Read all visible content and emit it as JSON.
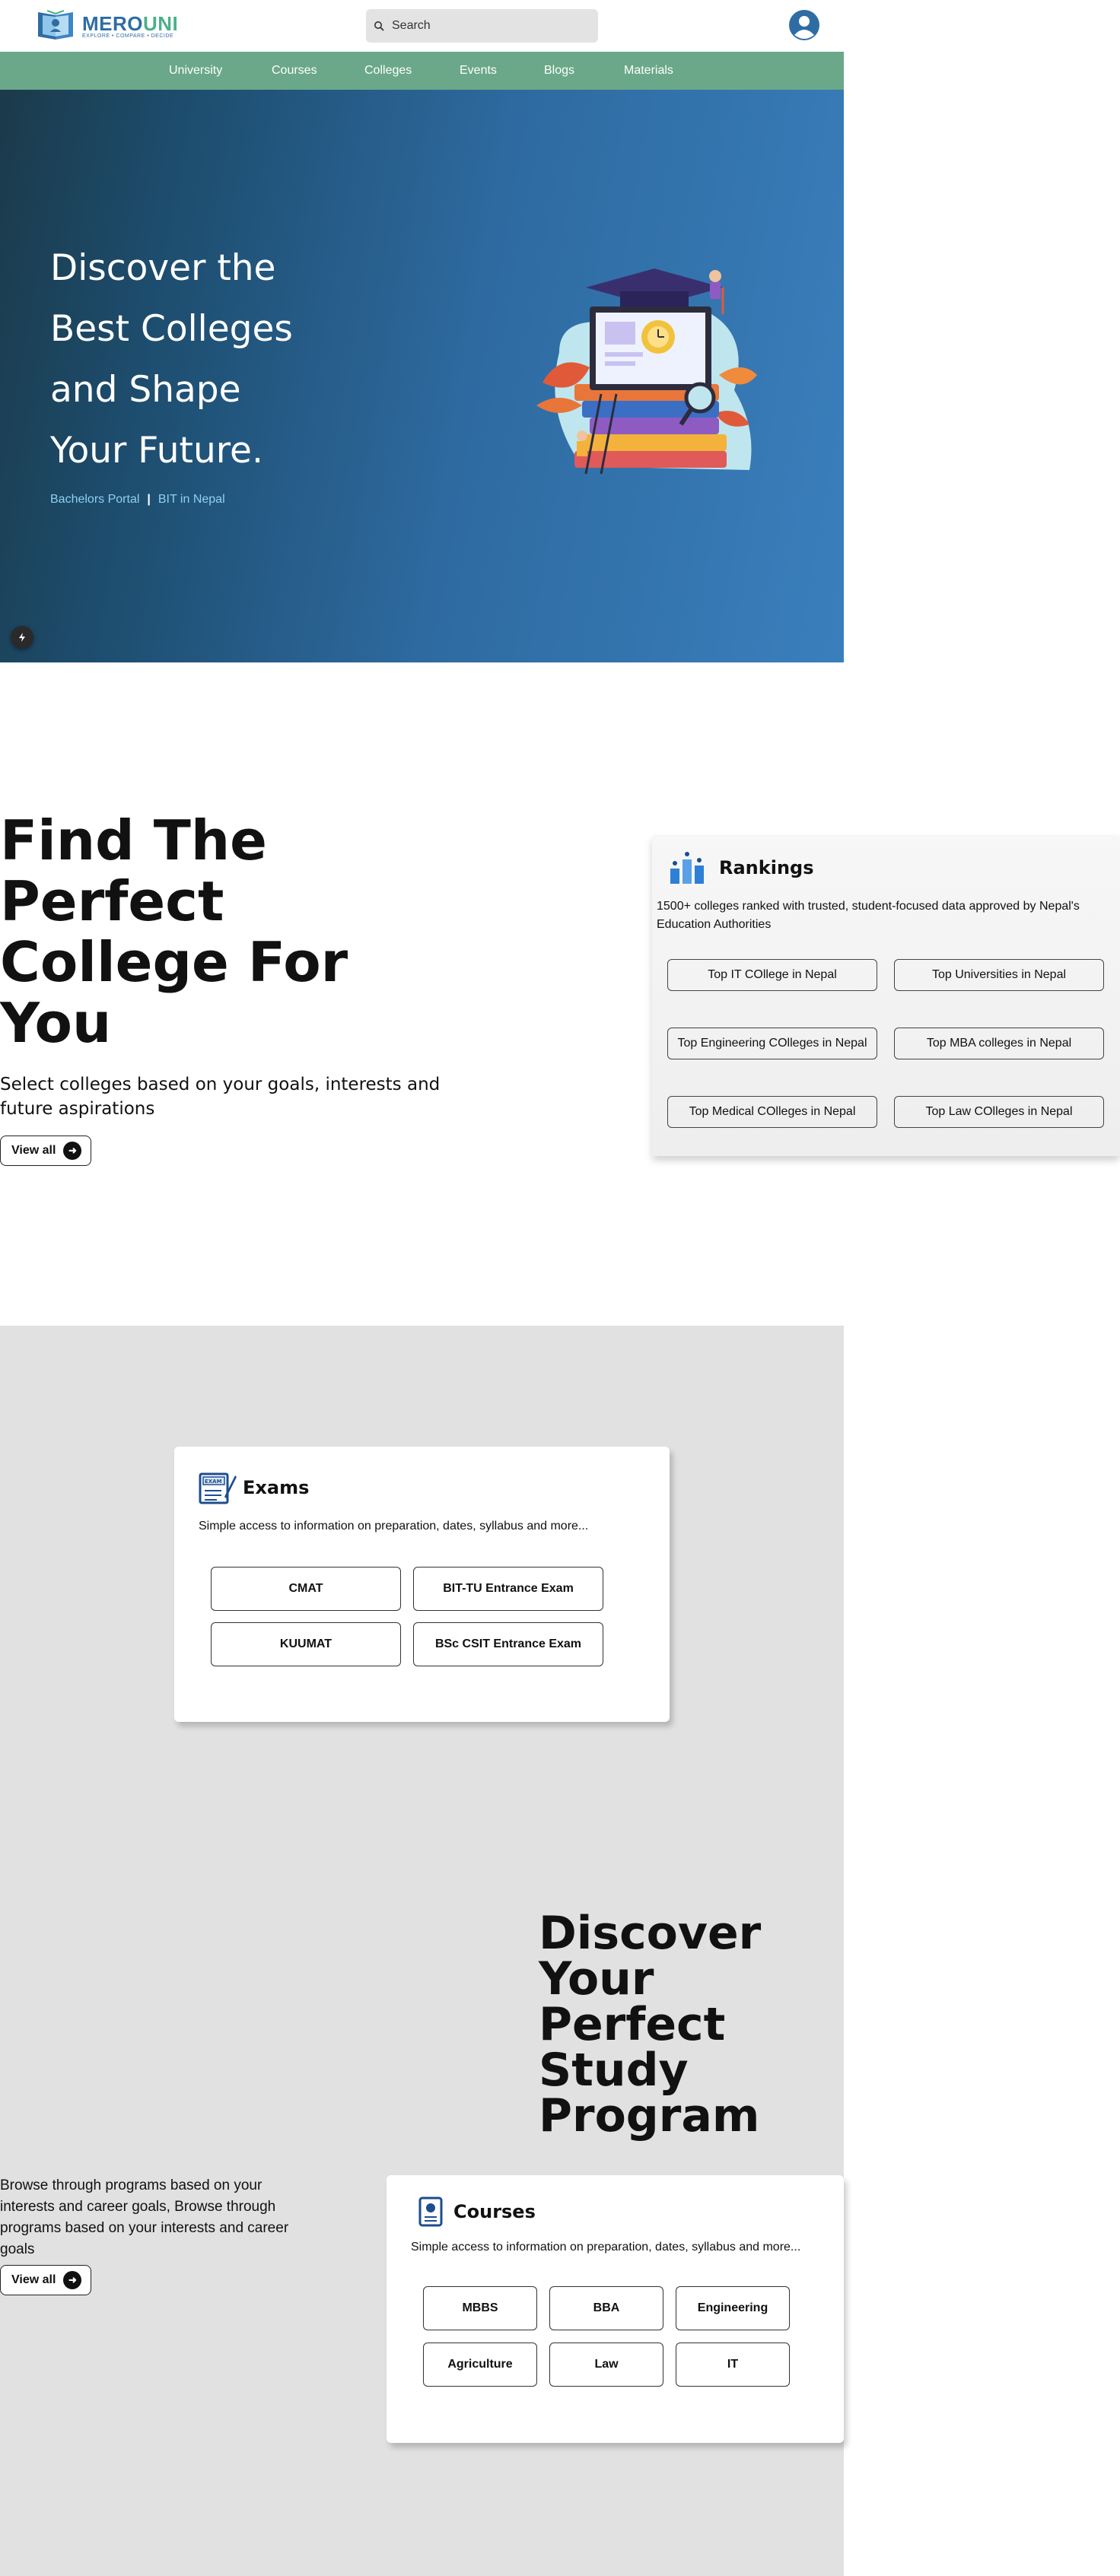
{
  "header": {
    "logo": {
      "title_a": "MERO",
      "title_b": "UNI",
      "tagline": "EXPLORE • COMPARE • DECIDE"
    },
    "search": {
      "placeholder": "Search"
    }
  },
  "nav": {
    "items": [
      {
        "label": "University"
      },
      {
        "label": "Courses"
      },
      {
        "label": "Colleges"
      },
      {
        "label": "Events"
      },
      {
        "label": "Blogs"
      },
      {
        "label": "Materials"
      }
    ]
  },
  "hero": {
    "title_lines": [
      "Discover the",
      "Best Colleges",
      "and Shape",
      "Your Future."
    ],
    "links": [
      "Bachelors Portal",
      "BIT in Nepal"
    ],
    "separator": "|"
  },
  "find": {
    "title_lines": [
      "Find The",
      "Perfect",
      "College For",
      "You"
    ],
    "subtitle": "Select colleges based on your goals, interests and future aspirations",
    "view_all": "View all"
  },
  "rankings": {
    "title": "Rankings",
    "description": "1500+ colleges ranked with trusted, student-focused data approved by Nepal's Education Authorities",
    "buttons": [
      "Top IT COllege in Nepal",
      "Top Universities in Nepal",
      "Top Engineering COlleges in Nepal",
      "Top MBA colleges in Nepal",
      "Top Medical COlleges in Nepal",
      "Top Law COlleges in Nepal"
    ]
  },
  "exams": {
    "title": "Exams",
    "description": "Simple access to information on preparation, dates, syllabus and more...",
    "buttons": [
      "CMAT",
      "BIT-TU Entrance Exam",
      "KUUMAT",
      "BSc CSIT Entrance Exam"
    ]
  },
  "discover": {
    "title_lines": [
      "Discover Your",
      "Perfect Study",
      "Program"
    ],
    "browse_text": "Browse through programs based on your interests and career goals, Browse through programs based on your interests and career goals",
    "view_all": "View all"
  },
  "courses": {
    "title": "Courses",
    "description": "Simple access to information on preparation, dates, syllabus and more...",
    "buttons": [
      "MBBS",
      "BBA",
      "Engineering",
      "Agriculture",
      "Law",
      "IT"
    ]
  },
  "colors": {
    "nav_green": "#6aa889",
    "hero_blue": "#3a7fbd",
    "brand_blue": "#2e6da4",
    "band_grey": "#e1e1e1"
  }
}
